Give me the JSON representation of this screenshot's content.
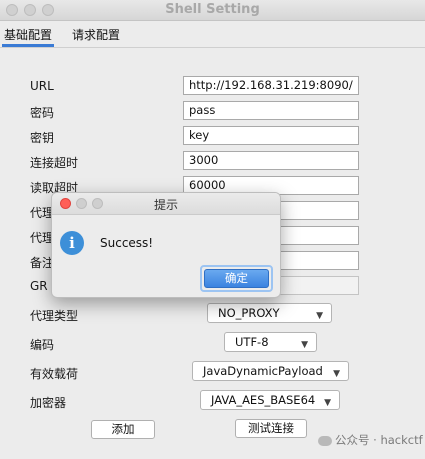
{
  "window": {
    "title": "Shell Setting"
  },
  "tabs": [
    {
      "label": "基础配置",
      "active": true
    },
    {
      "label": "请求配置",
      "active": false
    }
  ],
  "form": {
    "url_label": "URL",
    "url_value": "http://192.168.31.219:8090/",
    "password_label": "密码",
    "password_value": "pass",
    "key_label": "密钥",
    "key_value": "key",
    "connect_timeout_label": "连接超时",
    "connect_timeout_value": "3000",
    "read_timeout_label": "读取超时",
    "read_timeout_value": "60000",
    "proxy_host_label_partial": "代理",
    "proxy_port_label_partial": "代理",
    "remark_label_partial": "备注",
    "group_label_partial": "GR",
    "proxy_type_label": "代理类型",
    "proxy_type_value": "NO_PROXY",
    "encoding_label": "编码",
    "encoding_value": "UTF-8",
    "payload_label": "有效载荷",
    "payload_value": "JavaDynamicPayload",
    "cryption_label": "加密器",
    "cryption_value": "JAVA_AES_BASE64"
  },
  "buttons": {
    "add": "添加",
    "test_connection": "测试连接"
  },
  "dialog": {
    "title": "提示",
    "message": "Success!",
    "ok_label": "确定",
    "icon": "info-icon"
  },
  "watermark": {
    "text": "公众号 · hackctf"
  },
  "colors": {
    "accent": "#3b83e0",
    "close_dot": "#ff5f57",
    "info_icon": "#3d8fd8"
  }
}
